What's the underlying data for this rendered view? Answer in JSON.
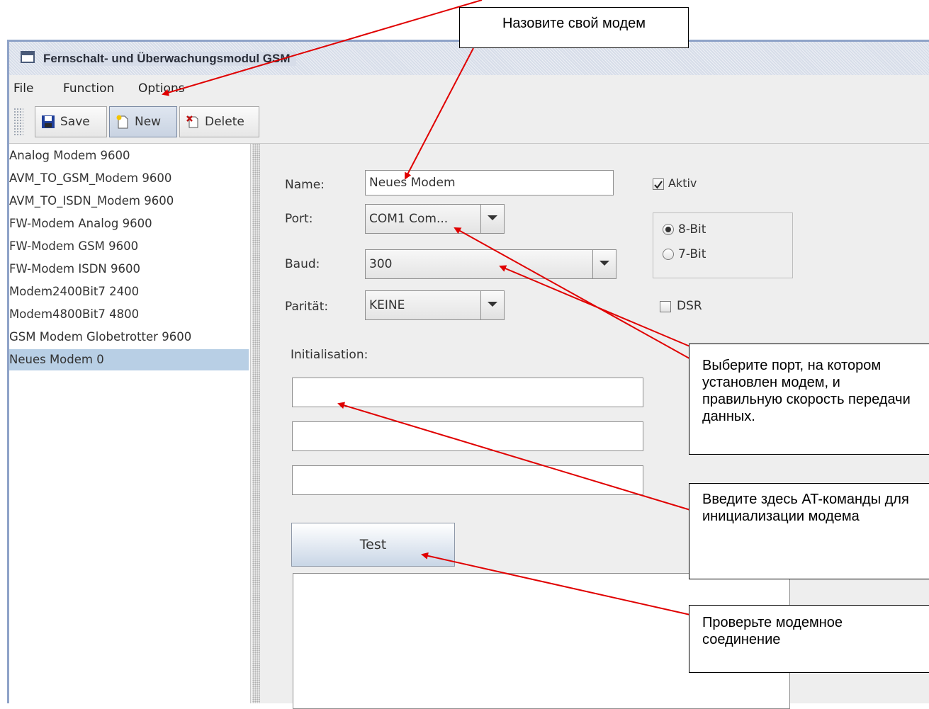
{
  "window": {
    "title": "Fernschalt- und Überwachungsmodul GSM",
    "menu": [
      "File",
      "Function",
      "Options"
    ],
    "toolbar": {
      "save": "Save",
      "new": "New",
      "delete": "Delete"
    }
  },
  "modem_list": [
    "Analog Modem 9600",
    "AVM_TO_GSM_Modem 9600",
    "AVM_TO_ISDN_Modem 9600",
    "FW-Modem Analog 9600",
    "FW-Modem GSM 9600",
    "FW-Modem ISDN 9600",
    "Modem2400Bit7 2400",
    "Modem4800Bit7 4800",
    "GSM Modem Globetrotter 9600",
    "Neues Modem 0"
  ],
  "selected_index": 9,
  "form": {
    "name_label": "Name:",
    "name_value": "Neues Modem",
    "port_label": "Port:",
    "port_value": "COM1 Com...",
    "baud_label": "Baud:",
    "baud_value": "300",
    "parity_label": "Parität:",
    "parity_value": "KEINE",
    "aktiv_label": "Aktiv",
    "aktiv_checked": true,
    "bit8_label": "8-Bit",
    "bit7_label": "7-Bit",
    "bits_selected": "8-Bit",
    "dsr_label": "DSR",
    "dsr_checked": false,
    "init_label": "Initialisation:",
    "init_values": [
      "",
      "",
      ""
    ],
    "test_label": "Test"
  },
  "annotations": {
    "name_callout": "Назовите свой модем",
    "port_callout": "Выберите порт, на котором установлен модем, и правильную скорость передачи данных.",
    "init_callout": "Введите здесь AT-команды для инициализации модема",
    "test_callout": "Проверьте модемное соединение",
    "arrow_color": "#e00000"
  }
}
